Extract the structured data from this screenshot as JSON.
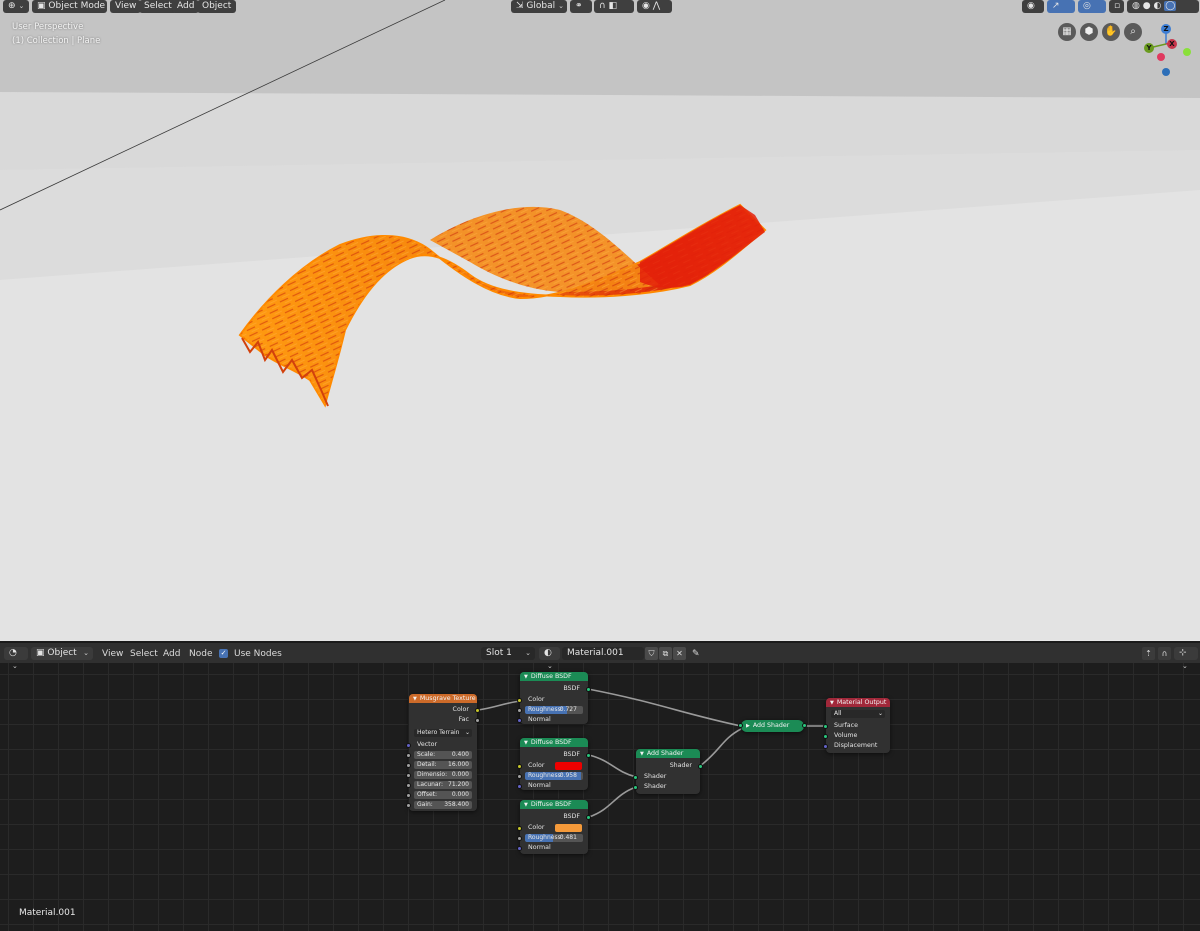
{
  "viewport": {
    "header": {
      "editor_type_icon": "view3d-icon",
      "mode": "Object Mode",
      "menus": [
        "View",
        "Select",
        "Add",
        "Object"
      ],
      "orientation": "Global",
      "snap_icon": "link-icon",
      "magnet_icon": "magnet-icon",
      "pivot_icon": "pivot-icon",
      "proportional_icon": "falloff-icon"
    },
    "info": {
      "perspective": "User Perspective",
      "collection": "(1) Collection | Plane"
    },
    "right_header_icons": [
      "visibility-icon",
      "gizmo-icon",
      "overlay-icon",
      "xray-icon",
      "wireframe-shading-icon",
      "solid-shading-icon",
      "material-shading-icon",
      "rendered-shading-icon"
    ],
    "nav_icons": [
      "grid-icon",
      "camera-icon",
      "hand-icon",
      "zoom-icon"
    ],
    "gizmo": {
      "x": "X",
      "y": "Y",
      "z": "Z"
    },
    "colors": {
      "object_orange": "#f59a1d",
      "object_red": "#e0240d",
      "accent_blue": "#4772b3"
    }
  },
  "node_editor": {
    "header": {
      "editor_type_icon": "node-editor-icon",
      "object_type": "Object",
      "menus": [
        "View",
        "Select",
        "Add",
        "Node"
      ],
      "use_nodes_label": "Use Nodes",
      "use_nodes_checked": true,
      "slot": "Slot 1",
      "material_name": "Material.001"
    },
    "footer_label": "Material.001",
    "nodes": {
      "musgrave": {
        "title": "Musgrave Texture",
        "outputs": [
          "Color",
          "Fac"
        ],
        "type_value": "Hetero Terrain",
        "vector_label": "Vector",
        "fields": [
          {
            "label": "Scale:",
            "value": "0.400"
          },
          {
            "label": "Detail:",
            "value": "16.000"
          },
          {
            "label": "Dimensio:",
            "value": "0.000"
          },
          {
            "label": "Lacunar:",
            "value": "71.200"
          },
          {
            "label": "Offset:",
            "value": "0.000"
          },
          {
            "label": "Gain:",
            "value": "358.400"
          }
        ]
      },
      "diffuse1": {
        "title": "Diffuse BSDF",
        "output": "BSDF",
        "color_label": "Color",
        "roughness_label": "Roughness:",
        "roughness_value": "0.727",
        "roughness": 0.727,
        "normal_label": "Normal"
      },
      "diffuse2": {
        "title": "Diffuse BSDF",
        "output": "BSDF",
        "color_label": "Color",
        "color": "#ee0000",
        "roughness_label": "Roughness:",
        "roughness_value": "0.958",
        "roughness": 0.958,
        "normal_label": "Normal"
      },
      "diffuse3": {
        "title": "Diffuse BSDF",
        "output": "BSDF",
        "color_label": "Color",
        "color": "#f59a3a",
        "roughness_label": "Roughness:",
        "roughness_value": "0.481",
        "roughness": 0.481,
        "normal_label": "Normal"
      },
      "add1": {
        "title": "Add Shader",
        "output": "Shader",
        "inputs": [
          "Shader",
          "Shader"
        ]
      },
      "add2": {
        "title": "Add Shader"
      },
      "output": {
        "title": "Material Output",
        "target": "All",
        "inputs": [
          "Surface",
          "Volume",
          "Displacement"
        ]
      }
    }
  }
}
